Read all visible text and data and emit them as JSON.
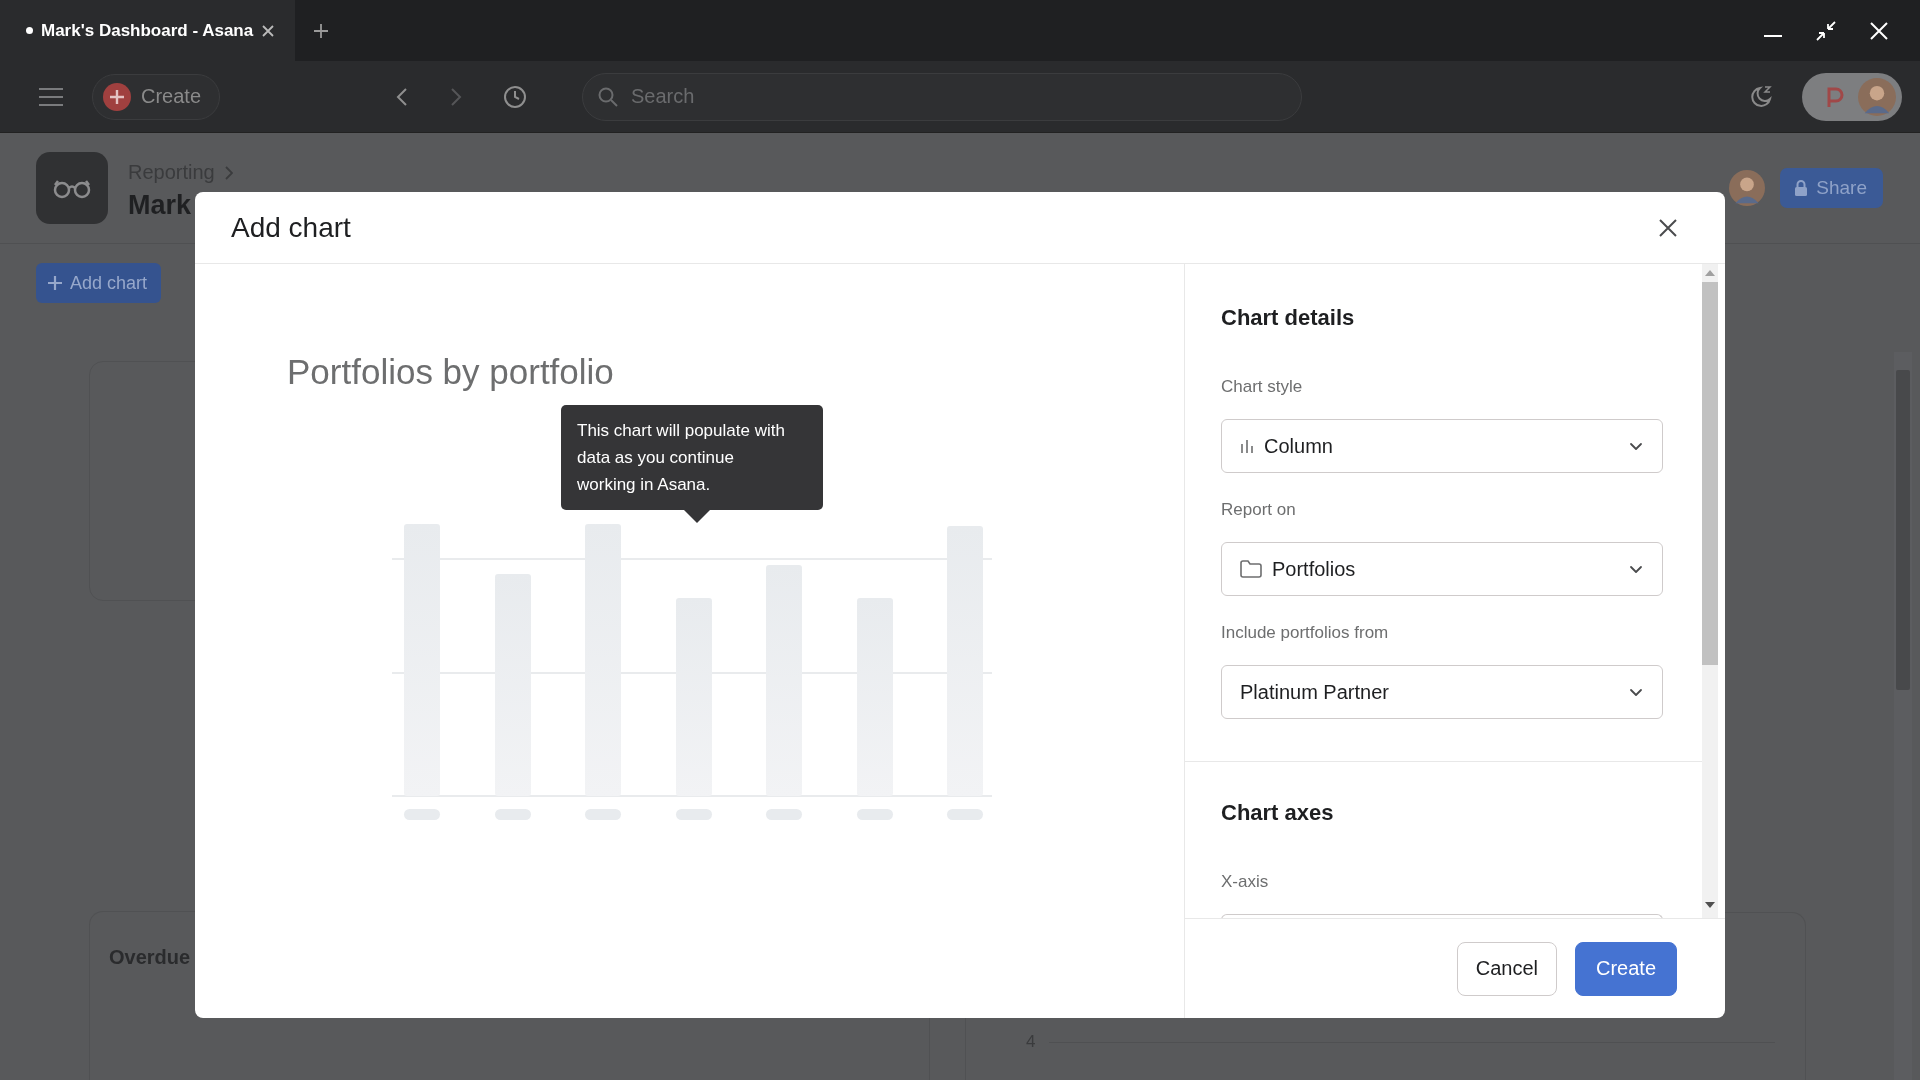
{
  "browser_tab": {
    "title": "Mark's Dashboard - Asana",
    "unsaved": true
  },
  "topbar": {
    "create_label": "Create",
    "search": {
      "placeholder": "Search"
    }
  },
  "page": {
    "breadcrumb": "Reporting",
    "title": "Mark",
    "share_label": "Share",
    "add_chart_label": "Add chart",
    "cards": [
      {
        "kind": "blank"
      },
      {
        "kind": "titled",
        "title": "Overdue"
      },
      {
        "kind": "axis",
        "axis_label": "4"
      }
    ]
  },
  "dialog": {
    "title": "Add chart",
    "preview": {
      "title": "Portfolios by portfolio",
      "tooltip": "This chart will populate with data as you continue working in Asana."
    },
    "sections": [
      {
        "heading": "Chart details",
        "fields": [
          {
            "label": "Chart style",
            "value": "Column",
            "kind": "column"
          },
          {
            "label": "Report on",
            "value": "Portfolios",
            "kind": "folder"
          },
          {
            "label": "Include portfolios from",
            "value": "Platinum Partner",
            "kind": "plain"
          }
        ]
      },
      {
        "heading": "Chart axes",
        "fields": [
          {
            "label": "X-axis",
            "kind": "cut"
          }
        ]
      }
    ],
    "buttons": [
      {
        "label": "Cancel",
        "kind": "secondary"
      },
      {
        "label": "Create",
        "kind": "primary"
      }
    ]
  }
}
